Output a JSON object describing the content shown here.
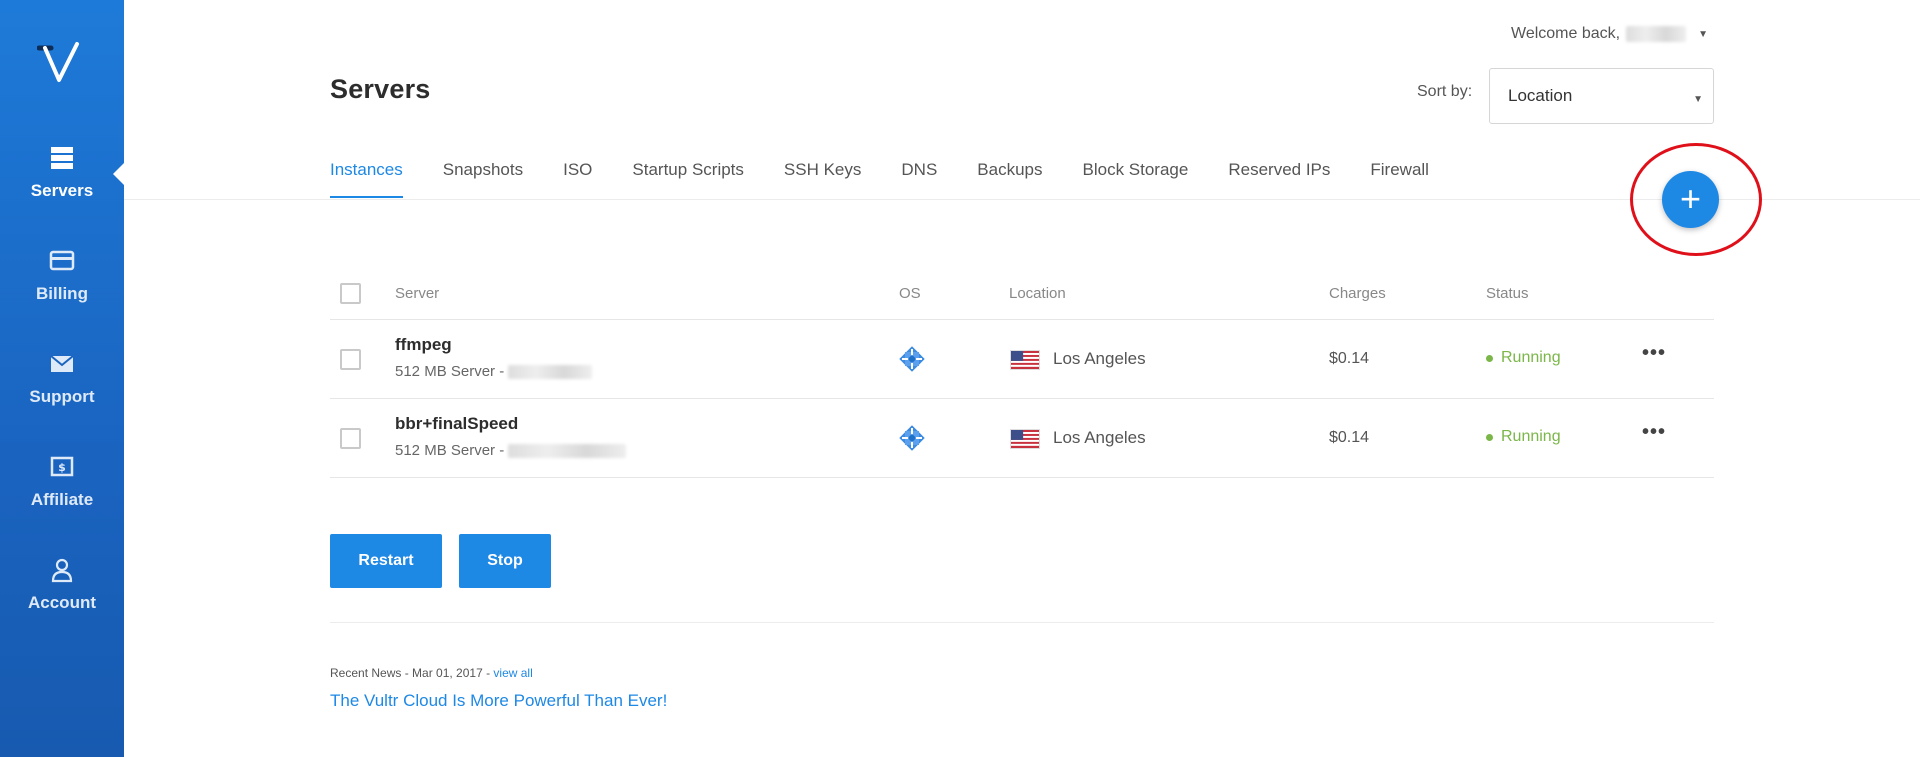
{
  "sidebar": {
    "logo_icon": "vultr-logo-icon",
    "items": [
      {
        "label": "Servers",
        "icon": "server-stack-icon",
        "active": true
      },
      {
        "label": "Billing",
        "icon": "credit-card-icon"
      },
      {
        "label": "Support",
        "icon": "envelope-icon"
      },
      {
        "label": "Affiliate",
        "icon": "dollar-bill-icon"
      },
      {
        "label": "Account",
        "icon": "user-icon"
      }
    ]
  },
  "header": {
    "welcome": "Welcome back,",
    "page_title": "Servers",
    "sort_label": "Sort by:",
    "sort_value": "Location"
  },
  "tabs": [
    {
      "label": "Instances",
      "active": true
    },
    {
      "label": "Snapshots"
    },
    {
      "label": "ISO"
    },
    {
      "label": "Startup Scripts"
    },
    {
      "label": "SSH Keys"
    },
    {
      "label": "DNS"
    },
    {
      "label": "Backups"
    },
    {
      "label": "Block Storage"
    },
    {
      "label": "Reserved IPs"
    },
    {
      "label": "Firewall"
    }
  ],
  "add_button": {
    "label": "+"
  },
  "table": {
    "columns": [
      "Server",
      "OS",
      "Location",
      "Charges",
      "Status"
    ],
    "rows": [
      {
        "name": "ffmpeg",
        "sub": "512 MB Server -",
        "os_icon": "centos-icon",
        "flag_icon": "us-flag-icon",
        "location": "Los Angeles",
        "charges": "$0.14",
        "status": "Running",
        "more": "•••"
      },
      {
        "name": "bbr+finalSpeed",
        "sub": "512 MB Server -",
        "os_icon": "centos-icon",
        "flag_icon": "us-flag-icon",
        "location": "Los Angeles",
        "charges": "$0.14",
        "status": "Running",
        "more": "•••"
      }
    ]
  },
  "actions": {
    "restart": "Restart",
    "stop": "Stop"
  },
  "news": {
    "meta": "Recent News - Mar 01, 2017 - ",
    "view_all": "view all",
    "headline": "The Vultr Cloud Is More Powerful Than Ever!"
  },
  "colors": {
    "accent": "#1e88e5",
    "status_running": "#7ab648",
    "annotation": "#e0101a"
  }
}
